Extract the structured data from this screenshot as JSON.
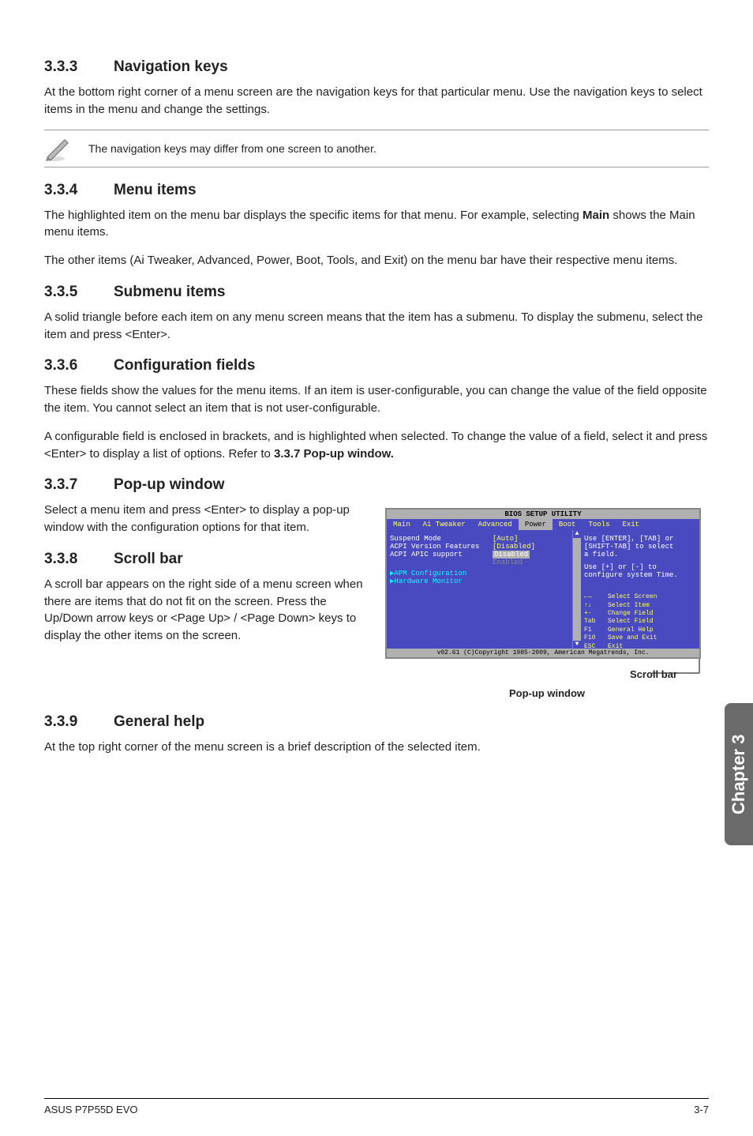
{
  "sections": {
    "s333": {
      "num": "3.3.3",
      "title": "Navigation keys",
      "p1": "At the bottom right corner of a menu screen are the navigation keys for that particular menu. Use the navigation keys to select items in the menu and change the settings.",
      "note": "The navigation keys may differ from one screen to another."
    },
    "s334": {
      "num": "3.3.4",
      "title": "Menu items",
      "p1": "The highlighted item on the menu bar displays the specific items for that menu. For example, selecting ",
      "p1b": "Main",
      "p1c": " shows the Main menu items.",
      "p2": "The other items (Ai Tweaker, Advanced, Power, Boot, Tools, and Exit) on the menu bar have their respective menu items."
    },
    "s335": {
      "num": "3.3.5",
      "title": "Submenu items",
      "p1": "A solid triangle before each item on any menu screen means that the item has a submenu. To display the submenu, select the item and press <Enter>."
    },
    "s336": {
      "num": "3.3.6",
      "title": "Configuration fields",
      "p1": "These fields show the values for the menu items. If an item is user-configurable, you can change the value of the field opposite the item. You cannot select an item that is not user-configurable.",
      "p2a": "A configurable field is enclosed in brackets, and is highlighted when selected. To change the value of a field, select it and press <Enter> to display a list of options. Refer to ",
      "p2b": "3.3.7 Pop-up window."
    },
    "s337": {
      "num": "3.3.7",
      "title": "Pop-up window",
      "p1": "Select a menu item and press <Enter> to display a pop-up window with the configuration options for that item."
    },
    "s338": {
      "num": "3.3.8",
      "title": "Scroll bar",
      "p1": "A scroll bar appears on the right side of a menu screen when there are items that do not fit on the screen. Press the Up/Down arrow keys or <Page Up> / <Page Down> keys to display the other items on the screen."
    },
    "s339": {
      "num": "3.3.9",
      "title": "General help",
      "p1": "At the top right corner of the menu screen is a brief description of the selected item."
    }
  },
  "bios": {
    "title": "BIOS SETUP UTILITY",
    "menubar": [
      "Main",
      "Ai Tweaker",
      "Advanced",
      "Power",
      "Boot",
      "Tools",
      "Exit"
    ],
    "options": {
      "suspend": {
        "label": "Suspend Mode",
        "value": "[Auto]"
      },
      "acpi_ver": {
        "label": "ACPI Version Features",
        "value": "[Disabled]"
      },
      "acpi_apic": {
        "label": "ACPI APIC support",
        "value": "Disabled"
      },
      "apic_enabled": {
        "label": "",
        "value": "Enabled"
      },
      "apm": {
        "label": "APM Configuration"
      },
      "hw": {
        "label": "Hardware Monitor"
      }
    },
    "help": {
      "l1": "Use [ENTER], [TAB] or",
      "l2": "[SHIFT-TAB] to select",
      "l3": "a field.",
      "l4": "Use [+] or [-] to",
      "l5": "configure system Time."
    },
    "keys": [
      {
        "k": "←→",
        "d": "Select Screen"
      },
      {
        "k": "↑↓",
        "d": "Select Item"
      },
      {
        "k": "+-",
        "d": "Change Field"
      },
      {
        "k": "Tab",
        "d": "Select Field"
      },
      {
        "k": "F1",
        "d": "General Help"
      },
      {
        "k": "F10",
        "d": "Save and Exit"
      },
      {
        "k": "ESC",
        "d": "Exit"
      }
    ],
    "footer": "v02.61 (C)Copyright 1985-2009, American Megatrends, Inc."
  },
  "captions": {
    "scroll": "Scroll bar",
    "popup": "Pop-up window"
  },
  "sidetab": "Chapter 3",
  "footer": {
    "left": "ASUS P7P55D EVO",
    "right": "3-7"
  }
}
